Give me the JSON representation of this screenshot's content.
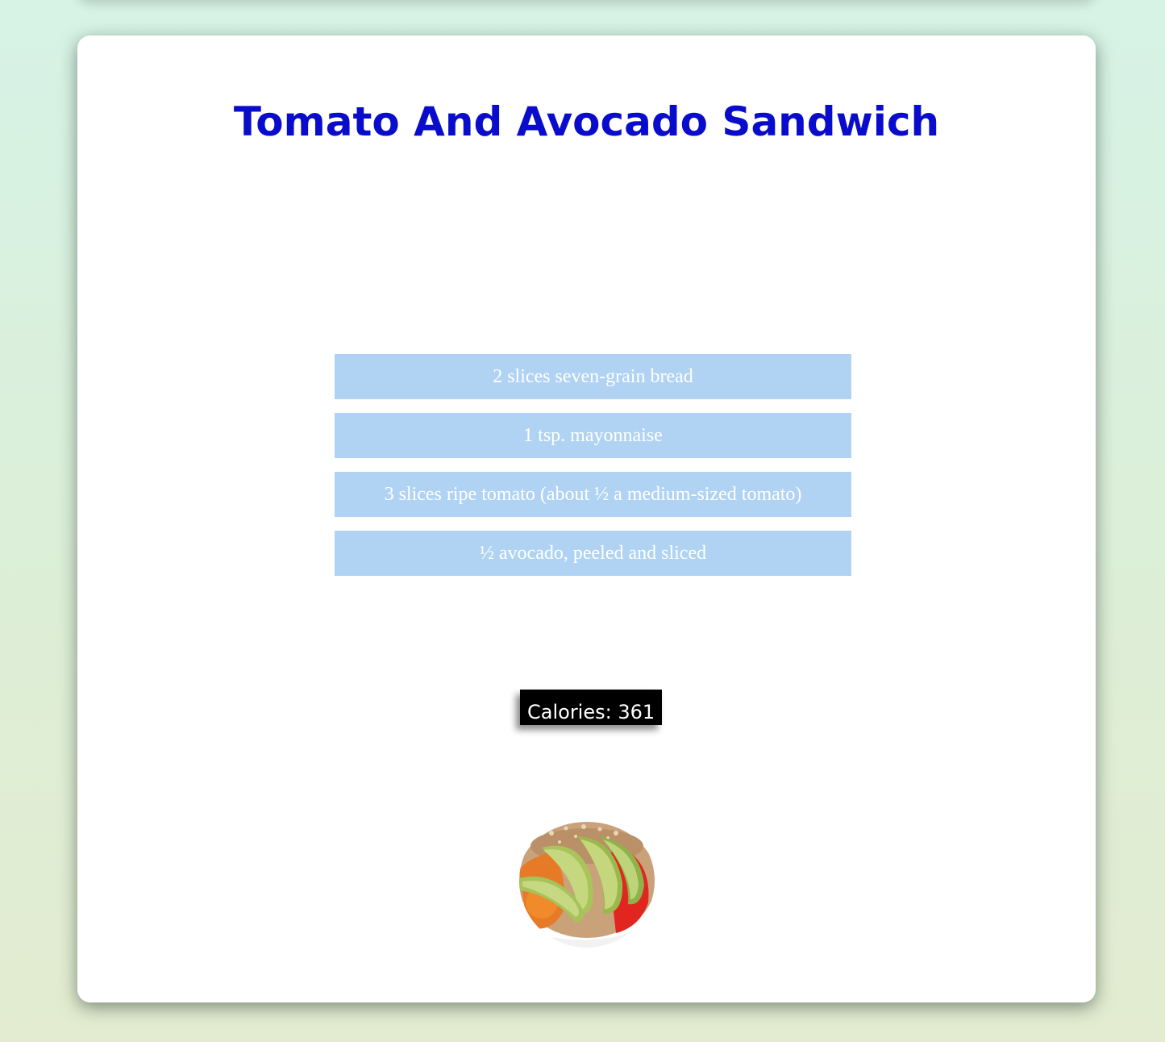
{
  "recipe": {
    "title": "Tomato And Avocado Sandwich",
    "ingredients": [
      "2 slices seven-grain bread",
      "1 tsp. mayonnaise",
      "3 slices ripe tomato (about ½ a medium-sized tomato)",
      "½ avocado, peeled and sliced"
    ],
    "calories_label": "Calories: 361",
    "image": {
      "icon": "sandwich-photo",
      "subject": "open-faced tomato and avocado sandwich"
    }
  },
  "colors": {
    "title": "#0a0ccc",
    "ingredient_bg": "#b0d3f3",
    "ingredient_text": "#ffffff",
    "calories_bg": "#000000",
    "card_bg": "#ffffff"
  }
}
